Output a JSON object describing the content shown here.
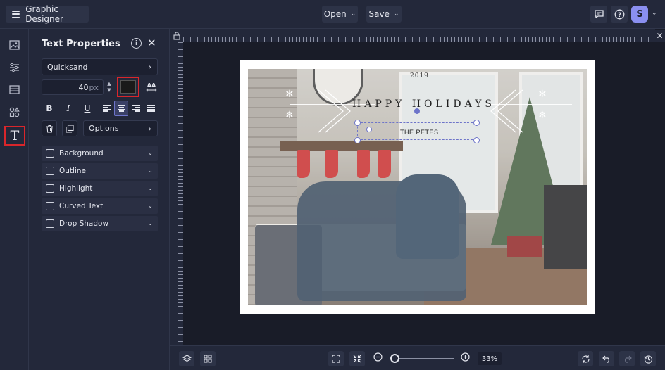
{
  "topbar": {
    "app_title": "Graphic Designer",
    "open_label": "Open",
    "save_label": "Save",
    "avatar_initial": "S"
  },
  "rail": {
    "items": [
      "images-icon",
      "adjustments-icon",
      "background-icon",
      "elements-icon",
      "text-tool-icon"
    ],
    "active": "text-tool-icon"
  },
  "text_panel": {
    "title": "Text Properties",
    "font_family": "Quicksand",
    "font_size": "40",
    "font_size_unit": "px",
    "text_color": "#1a1a1a",
    "alignment": "center",
    "options_label": "Options",
    "sections": [
      "Background",
      "Outline",
      "Highlight",
      "Curved Text",
      "Drop Shadow"
    ]
  },
  "canvas": {
    "year_text": "2019",
    "headline_text": "HAPPY HOLIDAYS",
    "family_text": "THE PETES"
  },
  "bottombar": {
    "zoom_level": "33%"
  },
  "colors": {
    "accent": "#6d74c9",
    "highlight_red": "#d9262b",
    "panel_bg": "#23283a"
  }
}
